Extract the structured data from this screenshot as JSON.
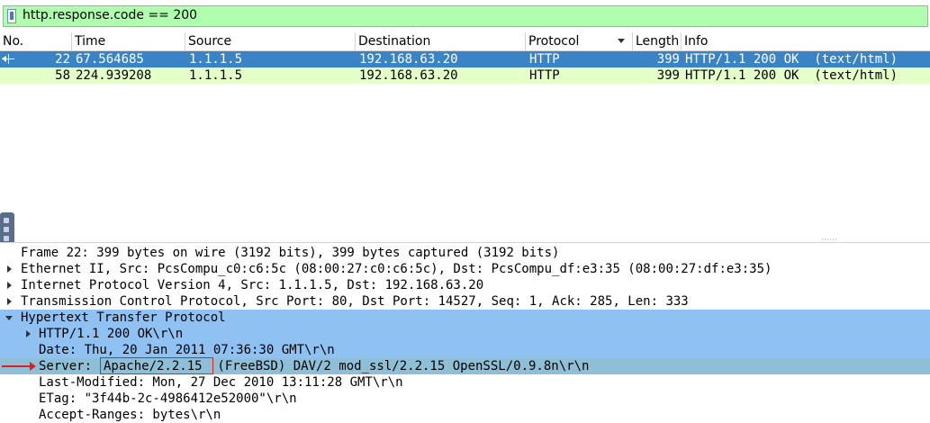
{
  "filter": {
    "value": "http.response.code == 200"
  },
  "packet_list": {
    "columns": [
      "No.",
      "Time",
      "Source",
      "Destination",
      "Protocol",
      "Length",
      "Info"
    ],
    "rows": [
      {
        "no": "22",
        "time": "67.564685",
        "source": "1.1.1.5",
        "destination": "192.168.63.20",
        "protocol": "HTTP",
        "length": "399",
        "info": "HTTP/1.1 200 OK  (text/html)"
      },
      {
        "no": "58",
        "time": "224.939208",
        "source": "1.1.1.5",
        "destination": "192.168.63.20",
        "protocol": "HTTP",
        "length": "399",
        "info": "HTTP/1.1 200 OK  (text/html)"
      }
    ]
  },
  "details": {
    "frame": "Frame 22: 399 bytes on wire (3192 bits), 399 bytes captured (3192 bits)",
    "ethernet": "Ethernet II, Src: PcsCompu_c0:c6:5c (08:00:27:c0:c6:5c), Dst: PcsCompu_df:e3:35 (08:00:27:df:e3:35)",
    "ip": "Internet Protocol Version 4, Src: 1.1.1.5, Dst: 192.168.63.20",
    "tcp": "Transmission Control Protocol, Src Port: 80, Dst Port: 14527, Seq: 1, Ack: 285, Len: 333",
    "http": "Hypertext Transfer Protocol",
    "status_line": "HTTP/1.1 200 OK\\r\\n",
    "date": "Date: Thu, 20 Jan 2011 07:36:30 GMT\\r\\n",
    "server_label": "Server: ",
    "server_value": "Apache/2.2.15",
    "server_rest": " (FreeBSD) DAV/2 mod_ssl/2.2.15 OpenSSL/0.9.8n\\r\\n",
    "last_modified": "Last-Modified: Mon, 27 Dec 2010 13:11:28 GMT\\r\\n",
    "etag": "ETag: \"3f44b-2c-4986412e52000\"\\r\\n",
    "accept_ranges": "Accept-Ranges: bytes\\r\\n"
  },
  "colors": {
    "filter_bg": "#afffaf",
    "selected_row": "#3a84c6",
    "http_row": "#e4ffc7",
    "highlight_row": "#8fc1f2",
    "annotation_red": "#e02020"
  }
}
